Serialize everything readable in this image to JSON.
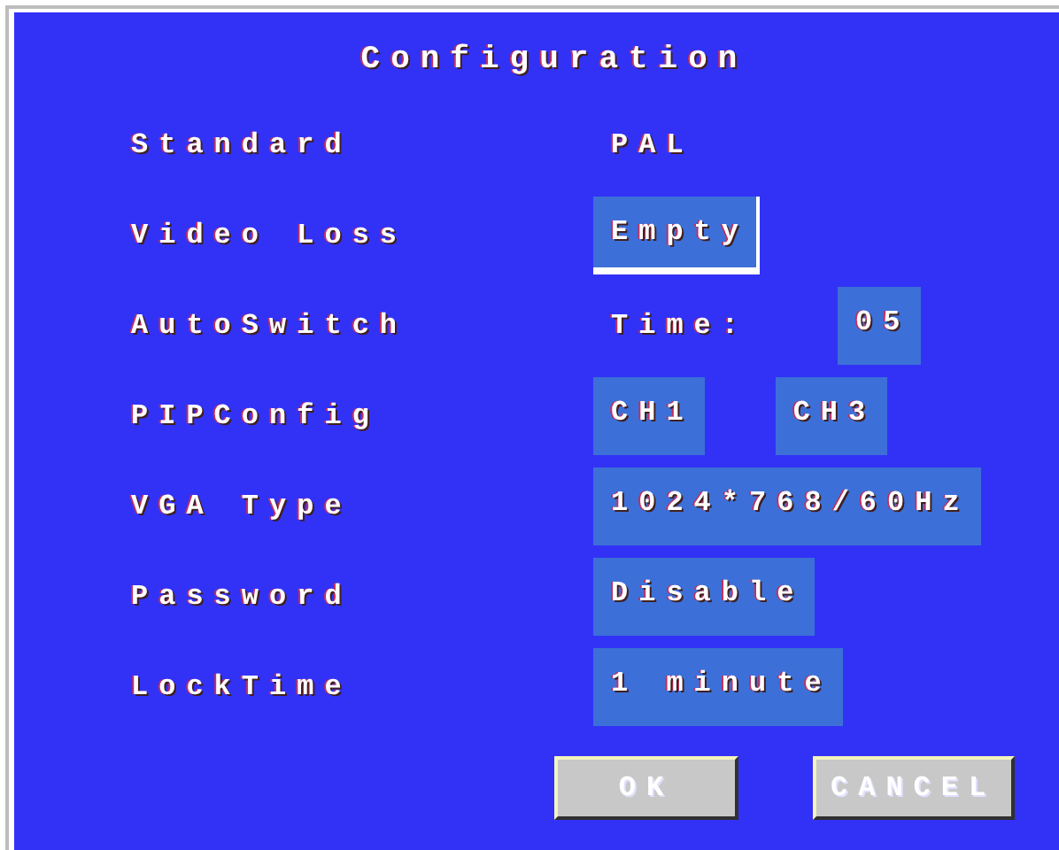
{
  "title": "Configuration",
  "rows": [
    {
      "label": "Standard",
      "fields": [
        {
          "kind": "plain",
          "text": "PAL"
        }
      ]
    },
    {
      "label": "Video Loss",
      "fields": [
        {
          "kind": "box",
          "text": "Empty",
          "selected": true
        }
      ]
    },
    {
      "label": "AutoSwitch",
      "fields": [
        {
          "kind": "plain",
          "text": "Time:"
        },
        {
          "kind": "box",
          "text": "05",
          "selected": false
        }
      ]
    },
    {
      "label": "PIPConfig",
      "fields": [
        {
          "kind": "box",
          "text": "CH1",
          "selected": false
        },
        {
          "kind": "box",
          "text": "CH3",
          "selected": false
        }
      ]
    },
    {
      "label": "VGA Type",
      "fields": [
        {
          "kind": "box",
          "text": "1024*768/60Hz",
          "selected": false
        }
      ]
    },
    {
      "label": "Password",
      "fields": [
        {
          "kind": "box",
          "text": "Disable",
          "selected": false
        }
      ]
    },
    {
      "label": "LockTime",
      "fields": [
        {
          "kind": "box",
          "text": "1 minute",
          "selected": false
        }
      ]
    }
  ],
  "buttons": [
    "OK",
    "CANCEL"
  ]
}
